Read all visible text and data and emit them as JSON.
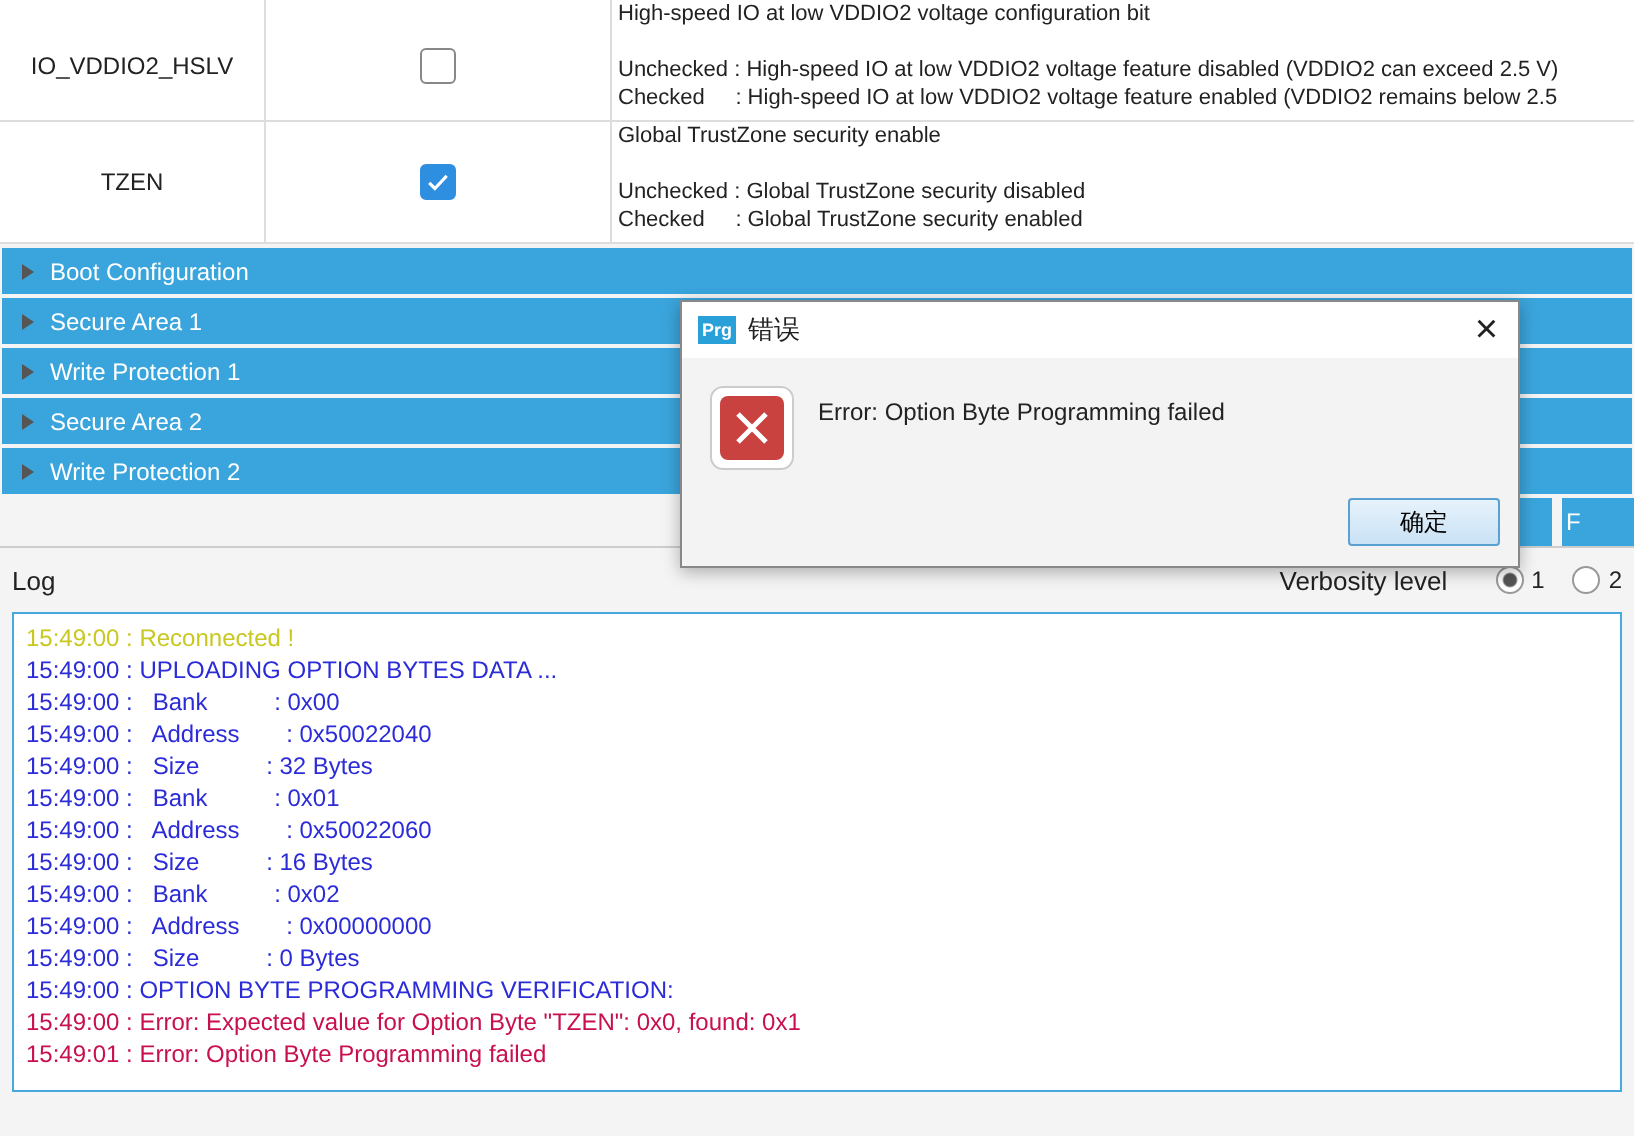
{
  "option_rows": [
    {
      "name": "IO_VDDIO2_HSLV",
      "checked": false,
      "title": "High-speed IO at low VDDIO2 voltage configuration bit",
      "unchecked_line": "Unchecked : High-speed IO at low VDDIO2 voltage feature disabled (VDDIO2 can exceed 2.5 V)",
      "checked_line": "Checked     : High-speed IO at low VDDIO2 voltage feature enabled (VDDIO2 remains below 2.5"
    },
    {
      "name": "TZEN",
      "checked": true,
      "title": "Global TrustZone security enable",
      "unchecked_line": "Unchecked : Global TrustZone security disabled",
      "checked_line": "Checked     : Global TrustZone security enabled"
    }
  ],
  "sections": [
    "Boot Configuration",
    "Secure Area 1",
    "Write Protection 1",
    "Secure Area 2",
    "Write Protection 2"
  ],
  "action_buttons": [
    {
      "kind": "blank"
    },
    {
      "kind": "labeled",
      "label": "F"
    }
  ],
  "log": {
    "title": "Log",
    "verbosity_label": "Verbosity level",
    "verbosity_options": [
      {
        "label": "1",
        "selected": true
      },
      {
        "label": "2",
        "selected": false
      }
    ],
    "lines": [
      {
        "kind": "info",
        "text": "15:49:00 : Reconnected !"
      },
      {
        "kind": "normal",
        "text": "15:49:00 : UPLOADING OPTION BYTES DATA ..."
      },
      {
        "kind": "normal",
        "text": "15:49:00 :   Bank          : 0x00"
      },
      {
        "kind": "normal",
        "text": "15:49:00 :   Address       : 0x50022040"
      },
      {
        "kind": "normal",
        "text": "15:49:00 :   Size          : 32 Bytes"
      },
      {
        "kind": "normal",
        "text": "15:49:00 :   Bank          : 0x01"
      },
      {
        "kind": "normal",
        "text": "15:49:00 :   Address       : 0x50022060"
      },
      {
        "kind": "normal",
        "text": "15:49:00 :   Size          : 16 Bytes"
      },
      {
        "kind": "normal",
        "text": "15:49:00 :   Bank          : 0x02"
      },
      {
        "kind": "normal",
        "text": "15:49:00 :   Address       : 0x00000000"
      },
      {
        "kind": "normal",
        "text": "15:49:00 :   Size          : 0 Bytes"
      },
      {
        "kind": "normal",
        "text": "15:49:00 : OPTION BYTE PROGRAMMING VERIFICATION:"
      },
      {
        "kind": "error",
        "text": "15:49:00 : Error: Expected value for Option Byte \"TZEN\": 0x0, found: 0x1"
      },
      {
        "kind": "error",
        "text": "15:49:01 : Error: Option Byte Programming failed"
      }
    ]
  },
  "dialog": {
    "app_badge": "Prg",
    "title": "错误",
    "close": "×",
    "message": "Error: Option Byte Programming failed",
    "ok_button": "确定"
  }
}
